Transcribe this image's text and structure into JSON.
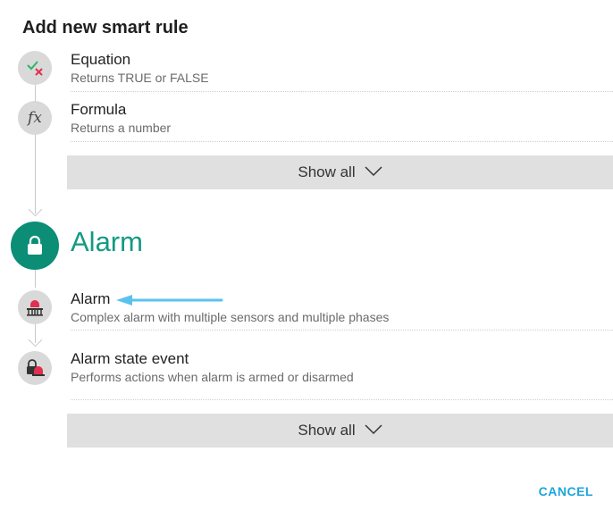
{
  "dialog": {
    "title": "Add new smart rule",
    "cancel_label": "CANCEL"
  },
  "groups": [
    {
      "items": [
        {
          "title": "Equation",
          "description": "Returns TRUE or FALSE",
          "icon": "check-cross-icon"
        },
        {
          "title": "Formula",
          "description": "Returns a number",
          "icon": "fx-icon",
          "icon_text": "fx"
        }
      ],
      "show_all_label": "Show all"
    },
    {
      "section_title": "Alarm",
      "section_icon": "padlock-icon",
      "items": [
        {
          "title": "Alarm",
          "description": "Complex alarm with multiple sensors and multiple phases",
          "icon": "alarm-siren-icon"
        },
        {
          "title": "Alarm state event",
          "description": "Performs actions when alarm is armed or disarmed",
          "icon": "alarm-lock-icon"
        }
      ],
      "show_all_label": "Show all"
    }
  ],
  "colors": {
    "accent_green": "#0b8d76",
    "accent_blue": "#1ea4dd",
    "annotation_arrow": "#5bc2ef"
  }
}
